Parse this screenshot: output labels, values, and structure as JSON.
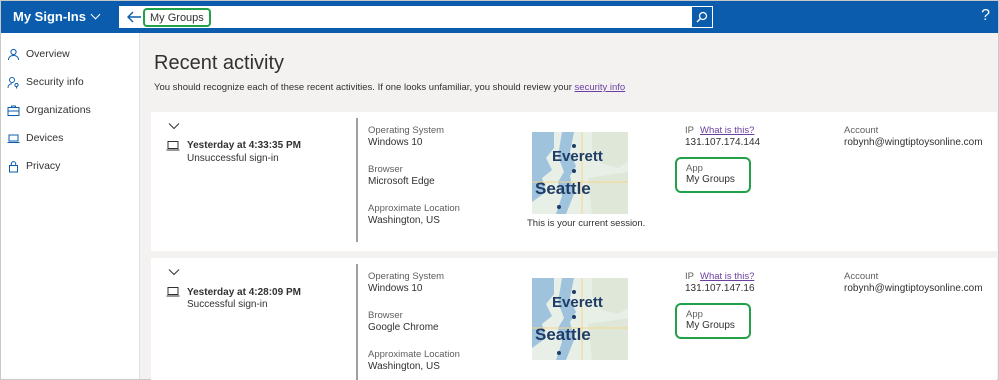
{
  "header": {
    "brand": "My Sign-Ins",
    "search_query": "My Groups",
    "help": "?"
  },
  "sidebar": {
    "items": [
      {
        "label": "Overview",
        "icon": "person-icon"
      },
      {
        "label": "Security info",
        "icon": "security-info-icon"
      },
      {
        "label": "Organizations",
        "icon": "briefcase-icon"
      },
      {
        "label": "Devices",
        "icon": "laptop-icon"
      },
      {
        "label": "Privacy",
        "icon": "lock-icon"
      }
    ]
  },
  "main": {
    "title": "Recent activity",
    "subtitle": "You should recognize each of these recent activities. If one looks unfamiliar, you should review your ",
    "subtitle_link": "security info"
  },
  "activities": [
    {
      "when": "Yesterday at 4:33:35 PM",
      "status": "Unsuccessful sign-in",
      "os_label": "Operating System",
      "os": "Windows 10",
      "browser_label": "Browser",
      "browser": "Microsoft Edge",
      "location_label": "Approximate Location",
      "location": "Washington, US",
      "map_city_top": "Everett",
      "map_city_bottom": "Seattle",
      "session_note": "This is your current session.",
      "ip_label": "IP",
      "ip_link": "What is this?",
      "ip": "131.107.174.144",
      "app_label": "App",
      "app": "My Groups",
      "account_label": "Account",
      "account": "robynh@wingtiptoysonline.com"
    },
    {
      "when": "Yesterday at 4:28:09 PM",
      "status": "Successful sign-in",
      "os_label": "Operating System",
      "os": "Windows 10",
      "browser_label": "Browser",
      "browser": "Google Chrome",
      "location_label": "Approximate Location",
      "location": "Washington, US",
      "map_city_top": "Everett",
      "map_city_bottom": "Seattle",
      "ip_label": "IP",
      "ip_link": "What is this?",
      "ip": "131.107.147.16",
      "app_label": "App",
      "app": "My Groups",
      "account_label": "Account",
      "account": "robynh@wingtiptoysonline.com"
    }
  ],
  "colors": {
    "header_blue": "#0b5cad",
    "highlight_green": "#22a14b",
    "link_purple": "#6b3fa0"
  }
}
